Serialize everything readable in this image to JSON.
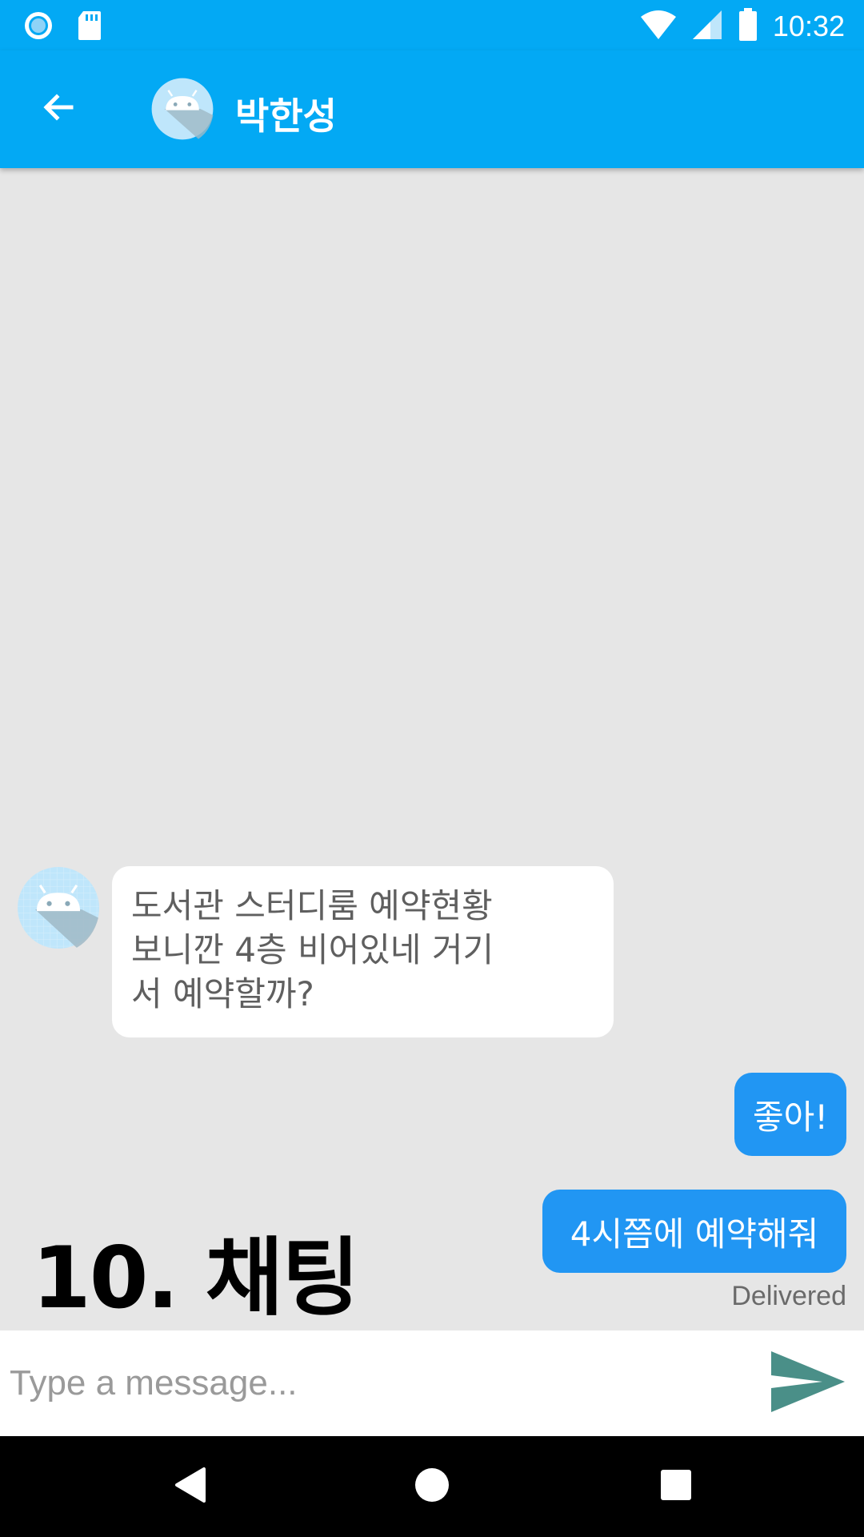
{
  "status_bar": {
    "time": "10:32",
    "left_icons": [
      "circle-notification-icon",
      "sd-card-icon"
    ],
    "right_icons": [
      "wifi-icon",
      "signal-icon",
      "battery-icon"
    ]
  },
  "app_bar": {
    "title": "박한성",
    "back_icon": "arrow-left-icon",
    "avatar_icon": "android-avatar-icon",
    "color": "#03a9f4"
  },
  "messages": [
    {
      "direction": "incoming",
      "lines": [
        "도서관 스터디룸 예약현황",
        "보니깐 4층 비어있네 거기",
        "서 예약할까?"
      ]
    },
    {
      "direction": "outgoing",
      "text": "좋아!"
    },
    {
      "direction": "outgoing",
      "text": "4시쯤에 예약해줘"
    }
  ],
  "delivered_label": "Delivered",
  "caption": "10. 채팅",
  "input": {
    "placeholder": "Type a message...",
    "value": "",
    "send_icon": "send-icon"
  },
  "nav_bar": {
    "icons": [
      "back-triangle-icon",
      "home-circle-icon",
      "recents-square-icon"
    ]
  },
  "colors": {
    "primary": "#03a9f4",
    "outgoing_bubble": "#2196f3",
    "send_icon": "#4a8f88",
    "chat_background": "#e6e6e6"
  }
}
